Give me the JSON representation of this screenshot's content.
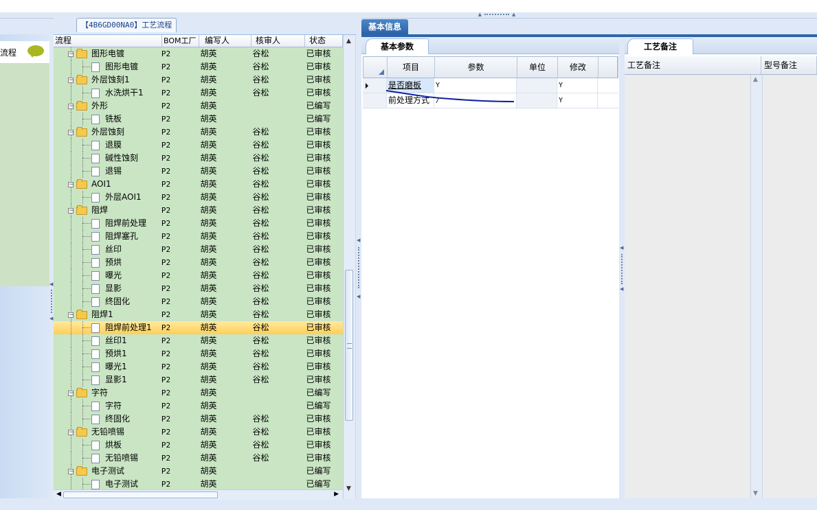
{
  "left_panel": {
    "label": "流程"
  },
  "tree": {
    "title": "【4B6GD00NA0】工艺流程",
    "columns": [
      "流程",
      "BOM工厂",
      "编写人",
      "核审人",
      "状态"
    ],
    "rows": [
      {
        "depth": 0,
        "type": "folder",
        "name": "图形电镀",
        "factory": "P2",
        "writer": "胡英",
        "reviewer": "谷松",
        "status": "已审核"
      },
      {
        "depth": 1,
        "type": "doc",
        "name": "图形电镀",
        "factory": "P2",
        "writer": "胡英",
        "reviewer": "谷松",
        "status": "已审核"
      },
      {
        "depth": 0,
        "type": "folder",
        "name": "外层蚀刻1",
        "factory": "P2",
        "writer": "胡英",
        "reviewer": "谷松",
        "status": "已审核"
      },
      {
        "depth": 1,
        "type": "doc",
        "name": "水洗烘干1",
        "factory": "P2",
        "writer": "胡英",
        "reviewer": "谷松",
        "status": "已审核"
      },
      {
        "depth": 0,
        "type": "folder",
        "name": "外形",
        "factory": "P2",
        "writer": "胡英",
        "reviewer": "",
        "status": "已编写"
      },
      {
        "depth": 1,
        "type": "doc",
        "name": "铣板",
        "factory": "P2",
        "writer": "胡英",
        "reviewer": "",
        "status": "已编写"
      },
      {
        "depth": 0,
        "type": "folder",
        "name": "外层蚀刻",
        "factory": "P2",
        "writer": "胡英",
        "reviewer": "谷松",
        "status": "已审核"
      },
      {
        "depth": 1,
        "type": "doc",
        "name": "退膜",
        "factory": "P2",
        "writer": "胡英",
        "reviewer": "谷松",
        "status": "已审核"
      },
      {
        "depth": 1,
        "type": "doc",
        "name": "碱性蚀刻",
        "factory": "P2",
        "writer": "胡英",
        "reviewer": "谷松",
        "status": "已审核"
      },
      {
        "depth": 1,
        "type": "doc",
        "name": "退锡",
        "factory": "P2",
        "writer": "胡英",
        "reviewer": "谷松",
        "status": "已审核"
      },
      {
        "depth": 0,
        "type": "folder",
        "name": "AOI1",
        "factory": "P2",
        "writer": "胡英",
        "reviewer": "谷松",
        "status": "已审核"
      },
      {
        "depth": 1,
        "type": "doc",
        "name": "外层AOI1",
        "factory": "P2",
        "writer": "胡英",
        "reviewer": "谷松",
        "status": "已审核"
      },
      {
        "depth": 0,
        "type": "folder",
        "name": "阻焊",
        "factory": "P2",
        "writer": "胡英",
        "reviewer": "谷松",
        "status": "已审核"
      },
      {
        "depth": 1,
        "type": "doc",
        "name": "阻焊前处理",
        "factory": "P2",
        "writer": "胡英",
        "reviewer": "谷松",
        "status": "已审核"
      },
      {
        "depth": 1,
        "type": "doc",
        "name": "阻焊塞孔",
        "factory": "P2",
        "writer": "胡英",
        "reviewer": "谷松",
        "status": "已审核"
      },
      {
        "depth": 1,
        "type": "doc",
        "name": "丝印",
        "factory": "P2",
        "writer": "胡英",
        "reviewer": "谷松",
        "status": "已审核"
      },
      {
        "depth": 1,
        "type": "doc",
        "name": "预烘",
        "factory": "P2",
        "writer": "胡英",
        "reviewer": "谷松",
        "status": "已审核"
      },
      {
        "depth": 1,
        "type": "doc",
        "name": "曝光",
        "factory": "P2",
        "writer": "胡英",
        "reviewer": "谷松",
        "status": "已审核"
      },
      {
        "depth": 1,
        "type": "doc",
        "name": "显影",
        "factory": "P2",
        "writer": "胡英",
        "reviewer": "谷松",
        "status": "已审核"
      },
      {
        "depth": 1,
        "type": "doc",
        "name": "终固化",
        "factory": "P2",
        "writer": "胡英",
        "reviewer": "谷松",
        "status": "已审核"
      },
      {
        "depth": 0,
        "type": "folder",
        "name": "阻焊1",
        "factory": "P2",
        "writer": "胡英",
        "reviewer": "谷松",
        "status": "已审核"
      },
      {
        "depth": 1,
        "type": "doc",
        "name": "阻焊前处理1",
        "factory": "P2",
        "writer": "胡英",
        "reviewer": "谷松",
        "status": "已审核",
        "selected": true
      },
      {
        "depth": 1,
        "type": "doc",
        "name": "丝印1",
        "factory": "P2",
        "writer": "胡英",
        "reviewer": "谷松",
        "status": "已审核"
      },
      {
        "depth": 1,
        "type": "doc",
        "name": "预烘1",
        "factory": "P2",
        "writer": "胡英",
        "reviewer": "谷松",
        "status": "已审核"
      },
      {
        "depth": 1,
        "type": "doc",
        "name": "曝光1",
        "factory": "P2",
        "writer": "胡英",
        "reviewer": "谷松",
        "status": "已审核"
      },
      {
        "depth": 1,
        "type": "doc",
        "name": "显影1",
        "factory": "P2",
        "writer": "胡英",
        "reviewer": "谷松",
        "status": "已审核"
      },
      {
        "depth": 0,
        "type": "folder",
        "name": "字符",
        "factory": "P2",
        "writer": "胡英",
        "reviewer": "",
        "status": "已编写"
      },
      {
        "depth": 1,
        "type": "doc",
        "name": "字符",
        "factory": "P2",
        "writer": "胡英",
        "reviewer": "",
        "status": "已编写"
      },
      {
        "depth": 1,
        "type": "doc",
        "name": "终固化",
        "factory": "P2",
        "writer": "胡英",
        "reviewer": "谷松",
        "status": "已审核"
      },
      {
        "depth": 0,
        "type": "folder",
        "name": "无铅喷锡",
        "factory": "P2",
        "writer": "胡英",
        "reviewer": "谷松",
        "status": "已审核"
      },
      {
        "depth": 1,
        "type": "doc",
        "name": "烘板",
        "factory": "P2",
        "writer": "胡英",
        "reviewer": "谷松",
        "status": "已审核"
      },
      {
        "depth": 1,
        "type": "doc",
        "name": "无铅喷锡",
        "factory": "P2",
        "writer": "胡英",
        "reviewer": "谷松",
        "status": "已审核"
      },
      {
        "depth": 0,
        "type": "folder",
        "name": "电子测试",
        "factory": "P2",
        "writer": "胡英",
        "reviewer": "",
        "status": "已编写"
      },
      {
        "depth": 1,
        "type": "doc",
        "name": "电子测试",
        "factory": "P2",
        "writer": "胡英",
        "reviewer": "",
        "status": "已编写"
      }
    ]
  },
  "basic_info": {
    "tab_label": "基本信息",
    "params_tab": "基本参数",
    "columns": {
      "item": "项目",
      "param": "参数",
      "unit": "单位",
      "modify": "修改"
    },
    "rows": [
      {
        "item": "是否磨板",
        "param": "Y",
        "unit": "",
        "modify": "Y",
        "current": true
      },
      {
        "item": "前处理方式",
        "param": "/",
        "unit": "",
        "modify": "Y",
        "current": false
      }
    ]
  },
  "notes": {
    "tab_label": "工艺备注",
    "col1": "工艺备注",
    "col2": "型号备注"
  }
}
